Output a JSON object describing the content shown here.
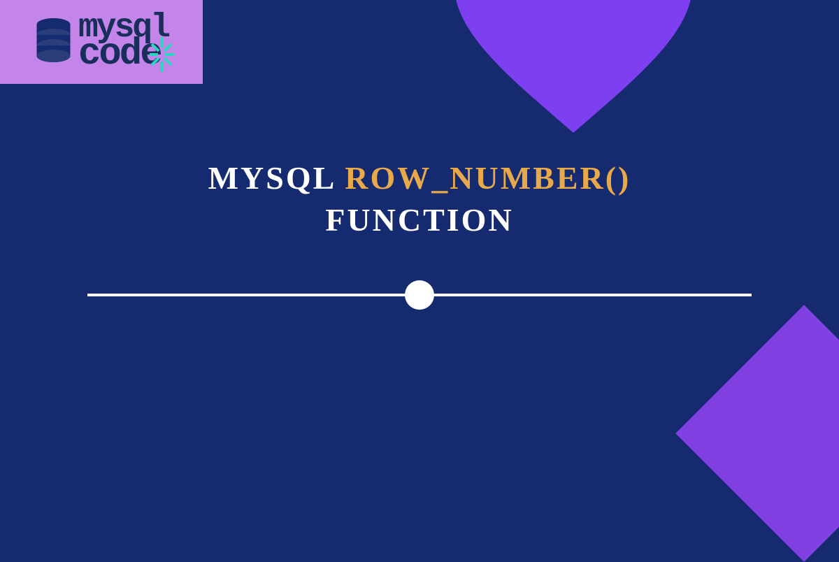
{
  "logo": {
    "mysql_text": "mysql",
    "code_text": "code"
  },
  "title": {
    "part1": "MYSQL",
    "part2": "ROW_NUMBER()",
    "part3": "FUNCTION"
  },
  "colors": {
    "background": "#162b6f",
    "logo_bg": "#c385e9",
    "heart": "#7d3ff0",
    "orange": "#e8a94a",
    "white": "#ffffff",
    "logo_text": "#1a2e5c",
    "sparkle": "#2dd4bf"
  }
}
